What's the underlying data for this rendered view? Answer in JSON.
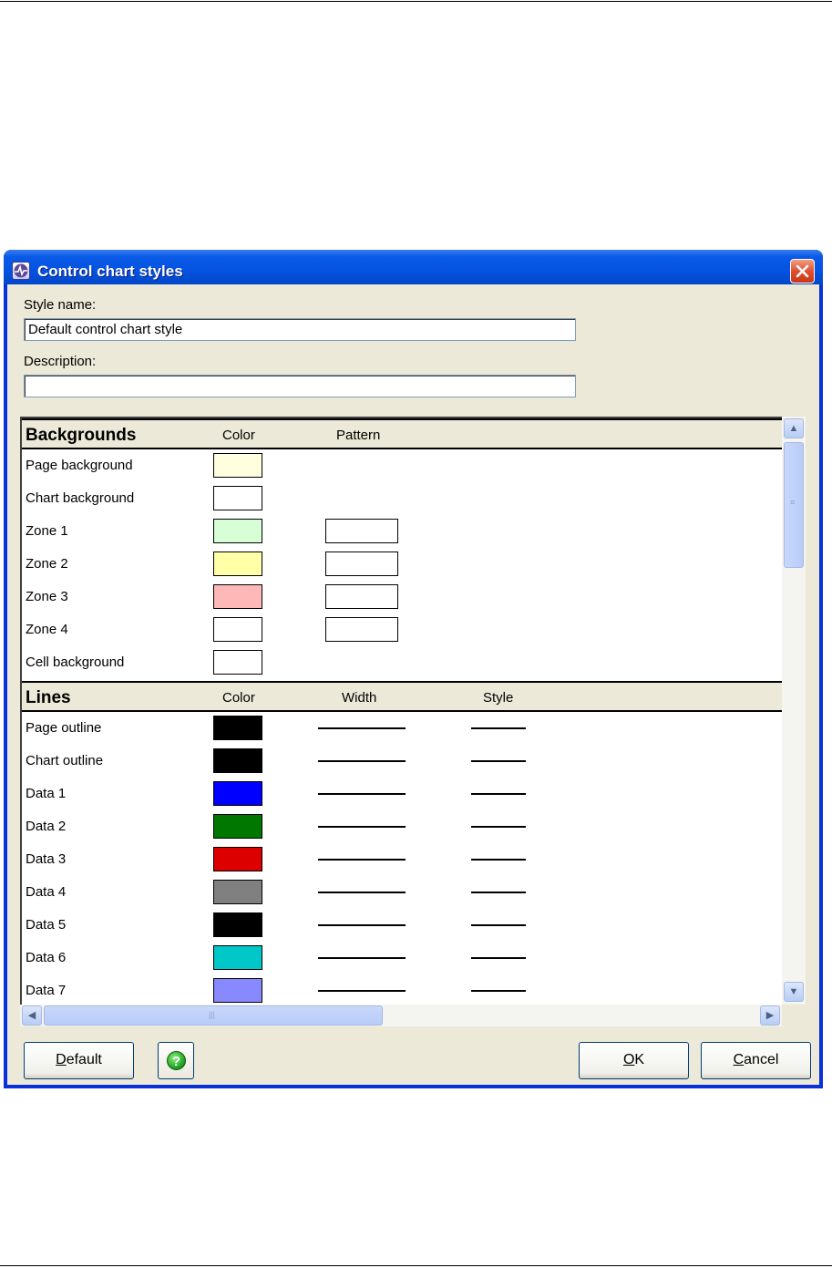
{
  "window": {
    "title": "Control chart styles",
    "icon": "chart-wave-icon"
  },
  "form": {
    "style_name_label": "Style name:",
    "style_name_value": "Default control chart style",
    "description_label": "Description:",
    "description_value": ""
  },
  "backgrounds": {
    "title": "Backgrounds",
    "col_color": "Color",
    "col_pattern": "Pattern",
    "rows": [
      {
        "label": "Page background",
        "color": "#ffffe0",
        "has_pattern": false
      },
      {
        "label": "Chart background",
        "color": "#ffffff",
        "has_pattern": false
      },
      {
        "label": "Zone 1",
        "color": "#d6ffd6",
        "has_pattern": true
      },
      {
        "label": "Zone 2",
        "color": "#ffffa8",
        "has_pattern": true
      },
      {
        "label": "Zone 3",
        "color": "#ffb8b8",
        "has_pattern": true
      },
      {
        "label": "Zone 4",
        "color": "#ffffff",
        "has_pattern": true
      },
      {
        "label": "Cell background",
        "color": "#ffffff",
        "has_pattern": false
      }
    ]
  },
  "lines": {
    "title": "Lines",
    "col_color": "Color",
    "col_width": "Width",
    "col_style": "Style",
    "rows": [
      {
        "label": "Page outline",
        "color": "#000000"
      },
      {
        "label": "Chart outline",
        "color": "#000000"
      },
      {
        "label": "Data 1",
        "color": "#0000ff"
      },
      {
        "label": "Data 2",
        "color": "#007800"
      },
      {
        "label": "Data 3",
        "color": "#dd0000"
      },
      {
        "label": "Data 4",
        "color": "#808080"
      },
      {
        "label": "Data 5",
        "color": "#000000"
      },
      {
        "label": "Data 6",
        "color": "#00c8c8"
      },
      {
        "label": "Data 7",
        "color": "#8888ff"
      }
    ]
  },
  "buttons": {
    "default_label": "Default",
    "default_mnemonic": "D",
    "ok_label": "OK",
    "ok_mnemonic": "O",
    "cancel_label": "Cancel",
    "cancel_mnemonic": "C",
    "help_icon": "help-icon"
  }
}
